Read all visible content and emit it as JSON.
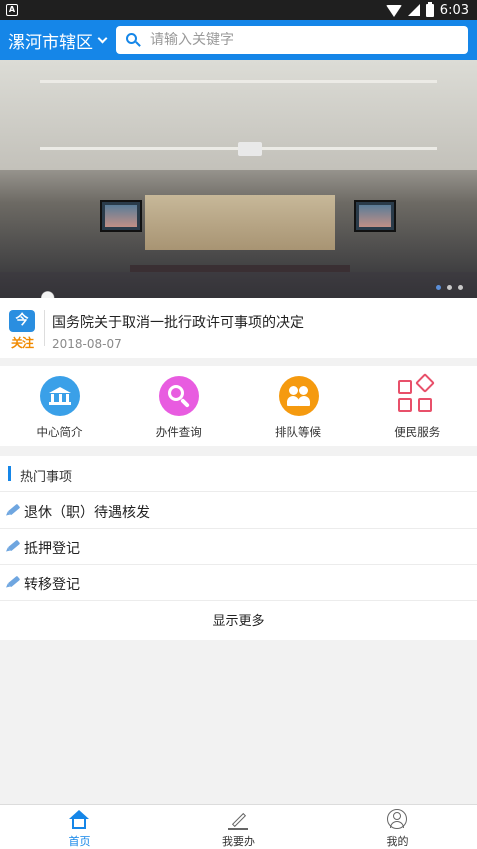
{
  "status_bar": {
    "notification_icon": "A",
    "time": "6:03"
  },
  "header": {
    "region": "漯河市辖区",
    "search_placeholder": "请输入关键字"
  },
  "banner": {
    "dots": 3,
    "active_dot": 0
  },
  "news": {
    "badge_icon": "今",
    "badge_label": "关注",
    "title": "国务院关于取消一批行政许可事项的决定",
    "date": "2018-08-07"
  },
  "quick_links": [
    {
      "label": "中心简介",
      "icon": "bank-icon",
      "color": "#3aa0e8"
    },
    {
      "label": "办件查询",
      "icon": "search-icon",
      "color": "#e85ce0"
    },
    {
      "label": "排队等候",
      "icon": "people-icon",
      "color": "#f59a0f"
    },
    {
      "label": "便民服务",
      "icon": "grid-icon",
      "color": "#e8506a"
    }
  ],
  "hot": {
    "title": "热门事项",
    "items": [
      "退休（职）待遇核发",
      "抵押登记",
      "转移登记"
    ],
    "more": "显示更多"
  },
  "bottom_nav": [
    {
      "label": "首页",
      "icon": "home-icon",
      "active": true
    },
    {
      "label": "我要办",
      "icon": "edit-icon",
      "active": false
    },
    {
      "label": "我的",
      "icon": "user-icon",
      "active": false
    }
  ],
  "colors": {
    "primary": "#1586e8",
    "accent_orange": "#f08a00"
  }
}
